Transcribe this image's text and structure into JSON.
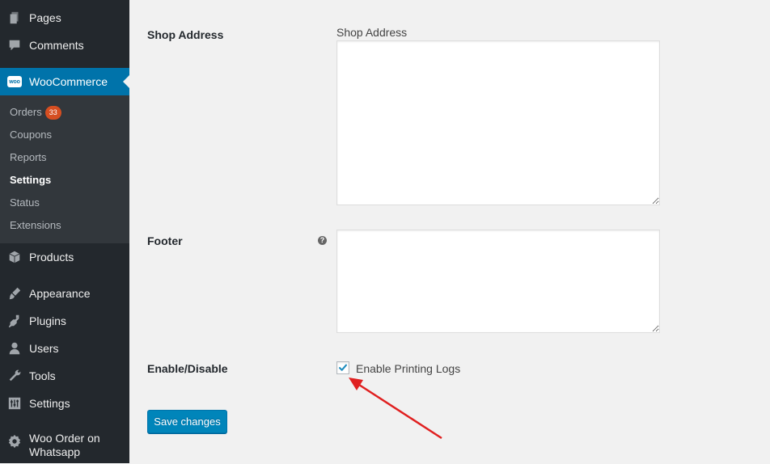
{
  "sidebar": {
    "items": [
      {
        "label": "Pages",
        "icon": "pages-icon"
      },
      {
        "label": "Comments",
        "icon": "comments-icon"
      },
      {
        "label": "WooCommerce",
        "icon": "woocommerce-icon",
        "logo_text": "woo"
      },
      {
        "label": "Products",
        "icon": "products-icon"
      },
      {
        "label": "Appearance",
        "icon": "appearance-icon"
      },
      {
        "label": "Plugins",
        "icon": "plugins-icon"
      },
      {
        "label": "Users",
        "icon": "users-icon"
      },
      {
        "label": "Tools",
        "icon": "tools-icon"
      },
      {
        "label": "Settings",
        "icon": "settings-icon"
      },
      {
        "label_line1": "Woo Order on",
        "label_line2": "Whatsapp",
        "icon": "gear-icon"
      }
    ],
    "submenu": [
      {
        "label": "Orders",
        "badge": "33"
      },
      {
        "label": "Coupons"
      },
      {
        "label": "Reports"
      },
      {
        "label": "Settings"
      },
      {
        "label": "Status"
      },
      {
        "label": "Extensions"
      }
    ]
  },
  "form": {
    "shop_address_label": "Shop Address",
    "shop_address_inner_label": "Shop Address",
    "shop_address_value": "",
    "footer_label": "Footer",
    "footer_help": "?",
    "footer_value": "",
    "enable_label": "Enable/Disable",
    "enable_checkbox_label": "Enable Printing Logs",
    "enable_checked": true,
    "save_label": "Save changes"
  },
  "colors": {
    "sidebar_bg": "#23282d",
    "submenu_bg": "#32373c",
    "active_bg": "#0073aa",
    "button_bg": "#0085ba",
    "badge_bg": "#d54e21",
    "arrow": "#e02020"
  }
}
